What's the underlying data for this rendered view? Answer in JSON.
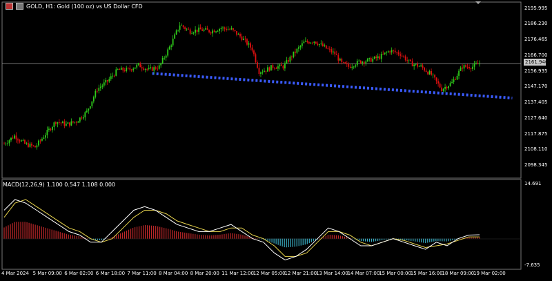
{
  "header": {
    "symbol_title": "GOLD, H1:  Gold (100 oz) vs US Dollar CFD"
  },
  "current_price": "2161.940",
  "colors": {
    "background": "#000000",
    "bull": "#2ecc1a",
    "bear": "#e01010",
    "trendline": "#3a5bff",
    "price_line": "#9a9a9a",
    "macd_main": "#ffffff",
    "macd_signal": "#e8d44d",
    "hist_pos": "#c0282a",
    "hist_neg": "#3aaec4",
    "grid": "#777777"
  },
  "macd": {
    "label": "MACD(12,26,9)",
    "values": "1.100 0.547 1.108 0.000",
    "ytick_top": "14.691",
    "ytick_bottom": "-7.635"
  },
  "chart_data": [
    {
      "type": "candlestick",
      "title": "GOLD, H1:  Gold (100 oz) vs US Dollar CFD",
      "y_ticks": [
        "2195.995",
        "2186.230",
        "2176.465",
        "2166.700",
        "2156.935",
        "2147.170",
        "2137.405",
        "2127.640",
        "2117.875",
        "2108.110",
        "2098.345"
      ],
      "x_ticks": [
        "4 Mar 2024",
        "5 Mar 09:00",
        "6 Mar 02:00",
        "6 Mar 18:00",
        "7 Mar 11:00",
        "8 Mar 04:00",
        "8 Mar 20:00",
        "11 Mar 12:00",
        "12 Mar 05:00",
        "12 Mar 21:00",
        "13 Mar 14:00",
        "14 Mar 07:00",
        "15 Mar 00:00",
        "15 Mar 16:00",
        "18 Mar 09:00",
        "19 Mar 02:00"
      ],
      "ylim": [
        2092,
        2198
      ],
      "price_path": [
        [
          0,
          2112
        ],
        [
          6,
          2117
        ],
        [
          12,
          2112
        ],
        [
          18,
          2110
        ],
        [
          24,
          2118
        ],
        [
          30,
          2126
        ],
        [
          36,
          2124
        ],
        [
          42,
          2126
        ],
        [
          48,
          2132
        ],
        [
          54,
          2146
        ],
        [
          60,
          2151
        ],
        [
          66,
          2158
        ],
        [
          72,
          2158
        ],
        [
          78,
          2161
        ],
        [
          84,
          2158
        ],
        [
          90,
          2160
        ],
        [
          96,
          2172
        ],
        [
          102,
          2186
        ],
        [
          108,
          2182
        ],
        [
          114,
          2183
        ],
        [
          120,
          2182
        ],
        [
          126,
          2184
        ],
        [
          132,
          2183
        ],
        [
          138,
          2178
        ],
        [
          144,
          2171
        ],
        [
          148,
          2157
        ],
        [
          152,
          2158
        ],
        [
          156,
          2160
        ],
        [
          162,
          2160
        ],
        [
          168,
          2168
        ],
        [
          174,
          2175
        ],
        [
          180,
          2176
        ],
        [
          186,
          2172
        ],
        [
          192,
          2168
        ],
        [
          196,
          2162
        ],
        [
          200,
          2160
        ],
        [
          206,
          2163
        ],
        [
          212,
          2164
        ],
        [
          218,
          2166
        ],
        [
          224,
          2170
        ],
        [
          230,
          2168
        ],
        [
          236,
          2162
        ],
        [
          242,
          2160
        ],
        [
          248,
          2155
        ],
        [
          254,
          2146
        ],
        [
          260,
          2150
        ],
        [
          266,
          2160
        ],
        [
          272,
          2160
        ],
        [
          276,
          2161.94
        ]
      ],
      "trendline": {
        "from": [
          86,
          2155.8
        ],
        "to": [
          295,
          2140.5
        ],
        "style": "dotted",
        "color": "#3a5bff"
      },
      "current_price": 2161.94
    },
    {
      "type": "line",
      "title": "MACD(12,26,9) 1.100 0.547 1.108 0.000",
      "ylim": [
        -7.635,
        14.691
      ],
      "series": [
        {
          "name": "MACD",
          "values": [
            8,
            11,
            10,
            8,
            6,
            4,
            2,
            1,
            -1,
            -1,
            2,
            5,
            8,
            9,
            8,
            6,
            4,
            3,
            2,
            2,
            3,
            4,
            2,
            0,
            -1,
            -4,
            -6,
            -5,
            -3,
            0,
            3,
            2,
            0,
            -2,
            -2,
            -1,
            0,
            -1,
            -2,
            -3,
            -1,
            -2,
            0,
            1,
            1.1
          ]
        },
        {
          "name": "Signal",
          "values": [
            6,
            10,
            11,
            9,
            7,
            5,
            3,
            2,
            0,
            -1,
            0,
            3,
            6,
            8,
            8,
            7,
            5,
            4,
            3,
            2,
            2,
            3,
            3,
            1,
            0,
            -2,
            -5,
            -5,
            -4,
            -1,
            2,
            2,
            1,
            -1,
            -2,
            -1,
            0,
            -0.5,
            -1.5,
            -2.5,
            -2,
            -1.5,
            -0.5,
            0.5,
            0.5
          ]
        }
      ]
    }
  ]
}
